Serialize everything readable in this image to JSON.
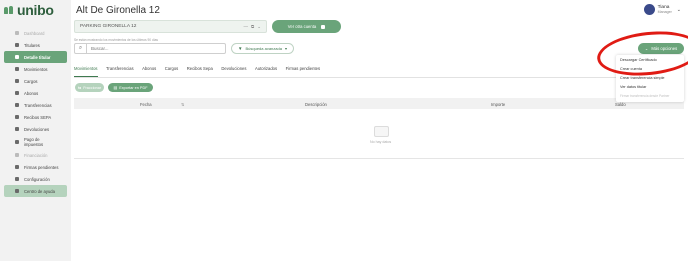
{
  "brand": {
    "name": "unibo"
  },
  "sidebar": {
    "items": [
      {
        "label": "Dashboard",
        "icon": "dashboard-icon",
        "state": "dim"
      },
      {
        "label": "Titulares",
        "icon": "users-icon",
        "state": "normal"
      },
      {
        "label": "Detalle titular",
        "icon": "user-icon",
        "state": "active"
      },
      {
        "label": "Movimientos",
        "icon": "list-icon",
        "state": "normal"
      },
      {
        "label": "Cargos",
        "icon": "charge-icon",
        "state": "normal"
      },
      {
        "label": "Abonos",
        "icon": "deposit-icon",
        "state": "normal"
      },
      {
        "label": "Transferencias",
        "icon": "transfer-icon",
        "state": "normal"
      },
      {
        "label": "Recibos SEPA",
        "icon": "receipt-icon",
        "state": "normal"
      },
      {
        "label": "Devoluciones",
        "icon": "return-icon",
        "state": "normal"
      },
      {
        "label": "Pago de impuestos",
        "icon": "tax-icon",
        "state": "two"
      },
      {
        "label": "Financiación",
        "icon": "finance-icon",
        "state": "dim"
      },
      {
        "label": "Firmas pendientes",
        "icon": "signature-icon",
        "state": "normal"
      },
      {
        "label": "Configuración",
        "icon": "gear-icon",
        "state": "normal"
      },
      {
        "label": "Centro de ayuda",
        "icon": "help-icon",
        "state": "help"
      }
    ]
  },
  "header": {
    "title": "Alt De Gironella 12"
  },
  "user": {
    "name": "Tiana",
    "role": "Manager"
  },
  "account": {
    "name": "PARKING GIRONELLA 12",
    "suffix": "—"
  },
  "buttons": {
    "other_account": "Ver otra cuenta",
    "advanced_search": "Búsqueda avanzada",
    "more_options": "Más opciones",
    "fraction": "Fraccionar",
    "export_pdf": "Exportar en PDF"
  },
  "hint": "Se están mostrando los movimientos de los últimos 90 días",
  "search": {
    "placeholder": "Buscar..."
  },
  "tabs": [
    {
      "label": "Movimientos",
      "active": true
    },
    {
      "label": "Transferencias",
      "active": false
    },
    {
      "label": "Abonos",
      "active": false
    },
    {
      "label": "Cargos",
      "active": false
    },
    {
      "label": "Recibos Sepa",
      "active": false
    },
    {
      "label": "Devoluciones",
      "active": false
    },
    {
      "label": "Autorizados",
      "active": false
    },
    {
      "label": "Firmas pendientes",
      "active": false
    }
  ],
  "table": {
    "columns": [
      "Fecha",
      "Descripción",
      "Importe",
      "Saldo"
    ],
    "empty_text": "No hay datos"
  },
  "dropdown": {
    "items": [
      {
        "label": "Descargar Certificado",
        "enabled": true
      },
      {
        "label": "Crear cuenta",
        "enabled": true
      },
      {
        "label": "Crear transferencia simple",
        "enabled": true
      },
      {
        "label": "Ver datos titular",
        "enabled": true
      },
      {
        "label": "Firmar transferencia desde Partner",
        "enabled": false
      }
    ]
  },
  "colors": {
    "accent": "#6aa47a",
    "accent_dark": "#3f7a50",
    "annotation": "#e01b14"
  }
}
